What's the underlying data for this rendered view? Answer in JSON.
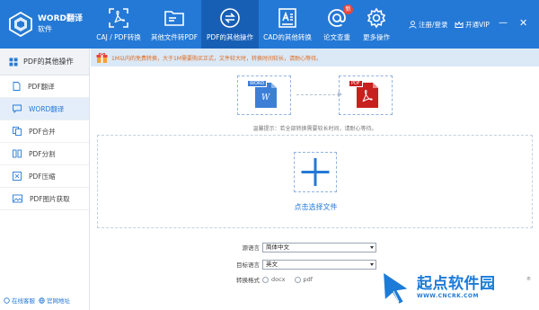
{
  "app": {
    "title": "WORD翻译",
    "subtitle": "软件"
  },
  "nav": {
    "tabs": [
      {
        "label": "CAJ / PDF转换",
        "icon": "pdf-convert-icon",
        "active": false
      },
      {
        "label": "其他文件转PDF",
        "icon": "folder-icon",
        "active": false
      },
      {
        "label": "PDF的其他操作",
        "icon": "refresh-icon",
        "active": true
      },
      {
        "label": "CAD的其他转换",
        "icon": "cad-icon",
        "active": false
      },
      {
        "label": "论文查重",
        "icon": "at-sign-icon",
        "active": false,
        "badge": "新"
      },
      {
        "label": "更多操作",
        "icon": "gear-icon",
        "active": false
      }
    ],
    "login": "注册/登录",
    "vip": "开通VIP"
  },
  "sidebar": {
    "header": "PDF的其他操作",
    "items": [
      {
        "label": "PDF翻译",
        "icon": "page-icon",
        "active": false
      },
      {
        "label": "WORD翻译",
        "icon": "chat-icon",
        "active": true
      },
      {
        "label": "PDF合并",
        "icon": "merge-icon",
        "active": false
      },
      {
        "label": "PDF分割",
        "icon": "split-icon",
        "active": false
      },
      {
        "label": "PDF压缩",
        "icon": "compress-icon",
        "active": false
      },
      {
        "label": "PDF图片获取",
        "icon": "image-icon",
        "active": false
      }
    ],
    "footer": {
      "service": "在线客服",
      "website": "官网地址"
    }
  },
  "main": {
    "notice": "1M以内的免费转换，大于1M需要购买正式，文件较大时，转换时间较长，请耐心等待。",
    "from_doc_label": "WORD",
    "from_doc_letter": "W",
    "to_doc_label": "PDF",
    "tip": "温馨提示：若全部转换需要较长时间，请耐心等待。",
    "select_file": "点击选择文件",
    "source_language": {
      "label": "源语言",
      "value": "简体中文"
    },
    "target_language": {
      "label": "目标语言",
      "value": "英文"
    },
    "format": {
      "label": "转换格式",
      "options": [
        "docx",
        "pdf"
      ]
    }
  },
  "watermark": {
    "title": "起点软件园",
    "url": "WWW.CNCRK.COM",
    "mark": "®"
  },
  "colors": {
    "primary": "#2479d6",
    "active_tab": "#175fb5",
    "pdf_red": "#c8201f",
    "word_blue": "#3d7fd6",
    "notice_text": "#e06a1a"
  }
}
